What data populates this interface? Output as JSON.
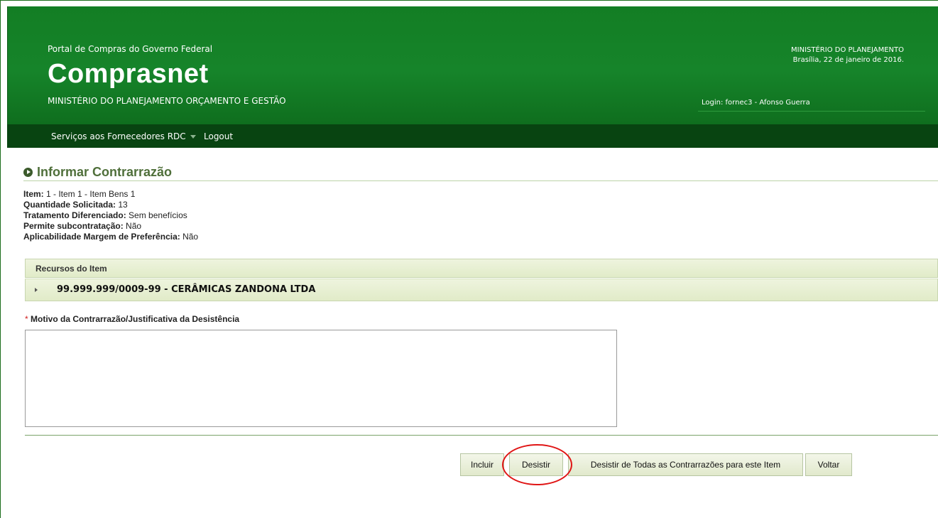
{
  "header": {
    "portal": "Portal de Compras do Governo Federal",
    "logo": "Comprasnet",
    "ministry": "MINISTÉRIO DO PLANEJAMENTO ORÇAMENTO E GESTÃO",
    "right_ministry": "MINISTÉRIO DO PLANEJAMENTO",
    "date": "Brasília, 22 de janeiro de 2016.",
    "login": "Login: fornec3 - Afonso Guerra"
  },
  "nav": {
    "services": "Serviços aos Fornecedores RDC",
    "logout": "Logout"
  },
  "page": {
    "title": "Informar Contrarrazão"
  },
  "info": [
    {
      "label": "Item:",
      "value": " 1 - Item 1 - Item Bens 1"
    },
    {
      "label": "Quantidade Solicitada:",
      "value": " 13"
    },
    {
      "label": "Tratamento Diferenciado:",
      "value": " Sem benefícios"
    },
    {
      "label": "Permite subcontratação:",
      "value": " Não"
    },
    {
      "label": "Aplicabilidade Margem de Preferência:",
      "value": " Não"
    }
  ],
  "section": {
    "title": "Recursos do Item",
    "item": "99.999.999/0009-99 - CERÂMICAS ZANDONA LTDA"
  },
  "field": {
    "required_mark": "*",
    "label": " Motivo da Contrarrazão/Justificativa da Desistência",
    "value": ""
  },
  "buttons": {
    "incluir": "Incluir",
    "desistir": "Desistir",
    "desistir_todas": "Desistir de Todas as Contrarrazões para este Item",
    "voltar": "Voltar"
  },
  "colors": {
    "header_green": "#16842a",
    "nav_dark": "#084411",
    "title_green": "#4f6f3a",
    "highlight_red": "#e01515"
  }
}
